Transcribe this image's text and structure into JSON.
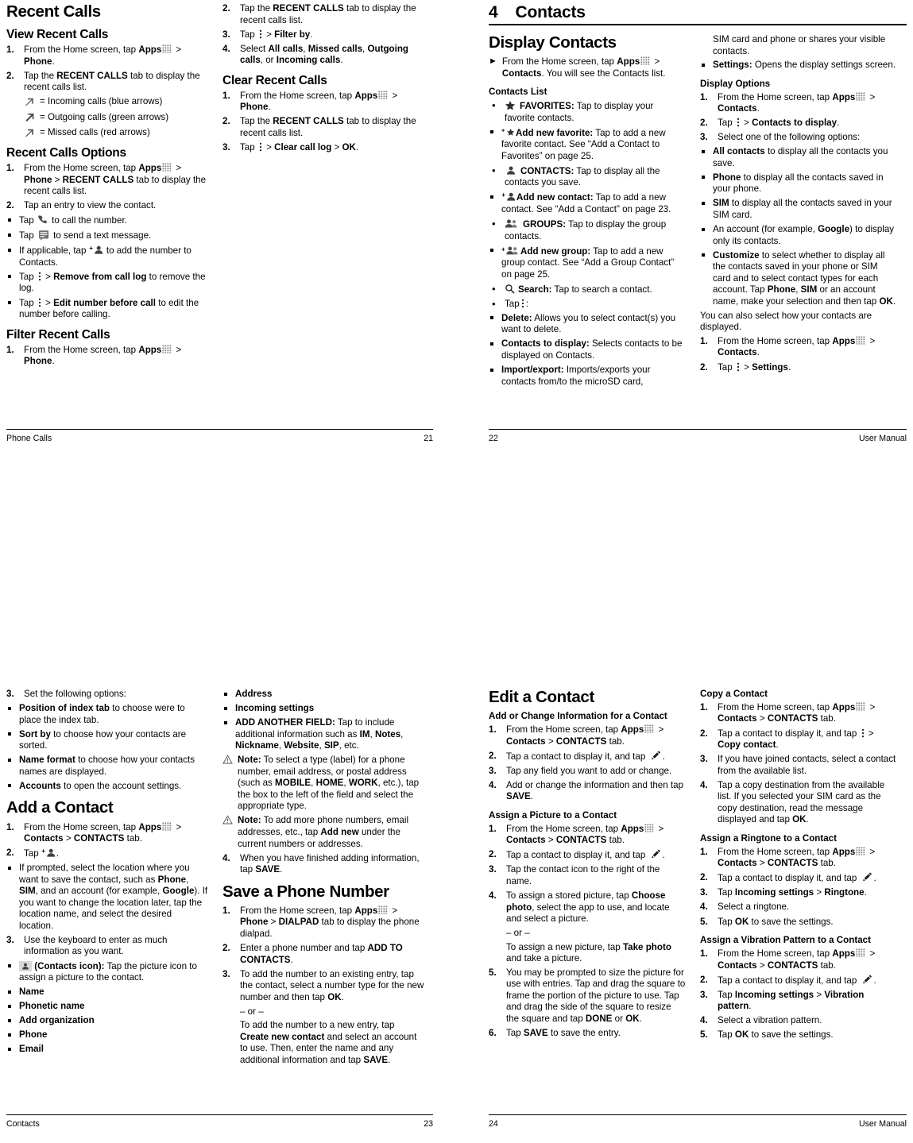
{
  "pages": {
    "p21": {
      "footer_left": "Phone Calls",
      "footer_right": "21",
      "col1": {
        "title": "Recent Calls",
        "s1_head": "View Recent Calls",
        "s1_1": "From the Home screen, tap ",
        "s1_1b": "Apps",
        "s1_1c": " > ",
        "s1_1d": "Phone",
        "s1_1e": ".",
        "s1_2": "Tap the ",
        "s1_2b": "RECENT CALLS",
        "s1_2c": " tab to display the recent calls list.",
        "legend_in": "= Incoming calls (blue arrows)",
        "legend_out": "= Outgoing calls (green arrows)",
        "legend_missed": "= Missed calls (red arrows)",
        "s2_head": "Recent Calls Options",
        "s2_1a": "From the Home screen, tap ",
        "s2_1b": "Apps",
        "s2_1c": " > ",
        "s2_1d": "Phone",
        "s2_1e": " > ",
        "s2_1f": "RECENT CALLS",
        "s2_1g": " tab to display the recent calls list.",
        "s2_2": "Tap an entry to view the contact.",
        "s2_2_a1": "Tap ",
        "s2_2_a2": " to call the number.",
        "s2_2_b1": "Tap ",
        "s2_2_b2": " to send a text message.",
        "s2_2_c1": "If applicable, tap ",
        "s2_2_c2": " to add the number to Contacts.",
        "s2_2_d1": "Tap ",
        "s2_2_d2": " > ",
        "s2_2_d3": "Remove from call log",
        "s2_2_d4": " to remove the log.",
        "s2_2_e1": "Tap ",
        "s2_2_e2": " > ",
        "s2_2_e3": "Edit number before call",
        "s2_2_e4": " to edit the number before calling.",
        "s3_head": "Filter Recent Calls",
        "s3_1a": "From the Home screen, tap ",
        "s3_1b": "Apps",
        "s3_1c": " > ",
        "s3_1d": "Phone",
        "s3_1e": "."
      },
      "col2": {
        "i2a": "Tap the ",
        "i2b": "RECENT CALLS",
        "i2c": " tab to display the recent calls list.",
        "i3a": "Tap ",
        "i3b": " > ",
        "i3c": "Filter by",
        "i3d": ".",
        "i4a": "Select ",
        "i4b": "All calls",
        "i4c": ", ",
        "i4d": "Missed calls",
        "i4e": ", ",
        "i4f": "Outgoing calls",
        "i4g": ", or ",
        "i4h": "Incoming calls",
        "i4i": ".",
        "s4_head": "Clear Recent Calls",
        "c1a": "From the Home screen, tap ",
        "c1b": "Apps",
        "c1c": " > ",
        "c1d": "Phone",
        "c1e": ".",
        "c2a": "Tap the ",
        "c2b": "RECENT CALLS",
        "c2c": " tab to display the recent calls list.",
        "c3a": "Tap ",
        "c3b": " > ",
        "c3c": "Clear call log",
        "c3d": " > ",
        "c3e": "OK",
        "c3f": "."
      }
    },
    "p22": {
      "footer_left": "22",
      "footer_right": "User Manual",
      "chapter_num": "4",
      "chapter_name": "Contacts",
      "col1": {
        "title": "Display Contacts",
        "arrow_a": "From the Home screen, tap ",
        "arrow_b": "Apps",
        "arrow_c": " > ",
        "arrow_d": "Contacts",
        "arrow_e": ". You will see the Contacts list.",
        "sub_head": "Contacts List",
        "fav_label": "FAVORITES:",
        "fav_text": " Tap to display your favorite contacts.",
        "addfav_label": "Add new favorite:",
        "addfav_text": " Tap to add a new favorite contact.  See “Add a Contact to Favorites” on page 25.",
        "con_label": "CONTACTS:",
        "con_text": " Tap to display all the contacts you save.",
        "addcon_label": "Add new contact:",
        "addcon_text": " Tap to add a new contact. See “Add a Contact” on page 23.",
        "grp_label": "GROUPS:",
        "grp_text": " Tap to display the group contacts.",
        "addgrp_label": "Add new group:",
        "addgrp_text": " Tap to add a new group contact. See “Add a Group Contact” on page 25.",
        "search_label": "Search:",
        "search_text": " Tap to search a contact.",
        "tap_kebab": "Tap",
        "tap_kebab_colon": ":",
        "del_label": "Delete:",
        "del_text": " Allows you to select contact(s) you want to delete.",
        "ctd_label": "Contacts to display:",
        "ctd_text": " Selects contacts to be displayed on Contacts.",
        "imp_label": "Import/export:",
        "imp_text": " Imports/exports your contacts from/to the microSD card,"
      },
      "col2": {
        "cont_text": "SIM card and phone or shares your visible contacts.",
        "set_label": "Settings:",
        "set_text": " Opens the display settings screen.",
        "opt_head": "Display Options",
        "o1a": "From the Home screen, tap ",
        "o1b": "Apps",
        "o1c": " > ",
        "o1d": "Contacts",
        "o1e": ".",
        "o2a": "Tap ",
        "o2b": " > ",
        "o2c": "Contacts to display",
        "o2d": ".",
        "o3": "Select one of the following options:",
        "opt_all_b": "All contacts",
        "opt_all_t": " to display all the contacts you save.",
        "opt_phone_b": "Phone",
        "opt_phone_t": " to display all the contacts saved in your phone.",
        "opt_sim_b": "SIM",
        "opt_sim_t": " to display all the contacts saved in your SIM card.",
        "opt_acct_t1": "An account (for example, ",
        "opt_acct_b": "Google",
        "opt_acct_t2": ") to display only its contacts.",
        "opt_cust_b": "Customize",
        "opt_cust_t1": " to select whether to display all the contacts saved in your phone or SIM card and to select contact types for each account. Tap ",
        "opt_cust_b2": "Phone",
        "opt_cust_t2": ", ",
        "opt_cust_b3": "SIM",
        "opt_cust_t3": " or an account name, make your selection and then tap ",
        "opt_cust_b4": "OK",
        "opt_cust_t4": ".",
        "also": "You can also select how your contacts are displayed.",
        "a1a": "From the Home screen, tap ",
        "a1b": "Apps",
        "a1c": " > ",
        "a1d": "Contacts",
        "a1e": ".",
        "a2a": "Tap ",
        "a2b": " > ",
        "a2c": "Settings",
        "a2d": "."
      }
    },
    "p23": {
      "footer_left": "Contacts",
      "footer_right": "23",
      "col1": {
        "s3": "Set the following options:",
        "o_pos_b": "Position of index tab",
        "o_pos_t": " to choose were to place the index tab.",
        "o_sort_b": "Sort by",
        "o_sort_t": " to choose how your contacts are sorted.",
        "o_name_b": "Name format",
        "o_name_t": " to choose how your contacts names are displayed.",
        "o_acct_b": "Accounts",
        "o_acct_t": " to open the account settings.",
        "title": "Add a Contact",
        "a1a": "From the Home screen, tap ",
        "a1b": "Apps",
        "a1c": " > ",
        "a1d": "Contacts",
        "a1e": " > ",
        "a1f": "CONTACTS",
        "a1g": " tab.",
        "a2a": "Tap ",
        "a2b": ".",
        "a2_sub1": "If prompted, select the location where you want to save the contact, such as ",
        "a2_sub_b1": "Phone",
        "a2_sub2": ", ",
        "a2_sub_b2": "SIM",
        "a2_sub3": ", and an account (for example, ",
        "a2_sub_b3": "Google",
        "a2_sub4": "). If you want to change the location later, tap the location name, and select the desired location.",
        "a3": "Use the keyboard to enter as much information as you want.",
        "a3_pic_b": "(Contacts icon):",
        "a3_pic_t": " Tap the picture icon to assign a picture to the contact.",
        "f_name": "Name",
        "f_phonetic": "Phonetic name",
        "f_org": "Add organization",
        "f_phone": "Phone",
        "f_email": "Email"
      },
      "col2": {
        "f_address": "Address",
        "f_incoming": "Incoming settings",
        "f_addfield_b": "ADD ANOTHER FIELD:",
        "f_addfield_t1": " Tap to include additional information such as ",
        "f_addfield_b1": "IM",
        "f_addfield_t2": ", ",
        "f_addfield_b2": "Notes",
        "f_addfield_t3": ", ",
        "f_addfield_b3": "Nickname",
        "f_addfield_t4": ", ",
        "f_addfield_b4": "Website",
        "f_addfield_t5": ", ",
        "f_addfield_b5": "SIP",
        "f_addfield_t6": ", etc.",
        "note1_b": "Note:",
        "note1_t1": " To select a type (label) for a phone number, email address, or postal address (such as ",
        "note1_b1": "MOBILE",
        "note1_t2": ", ",
        "note1_b2": "HOME",
        "note1_t3": ", ",
        "note1_b3": "WORK",
        "note1_t4": ", etc.), tap the box to the left of the field and select the appropriate type.",
        "note2_b": "Note:",
        "note2_t1": " To add more phone numbers, email addresses, etc., tap ",
        "note2_b1": "Add new",
        "note2_t2": " under the current numbers or addresses.",
        "a4a": "When you have finished adding information, tap ",
        "a4b": "SAVE",
        "a4c": ".",
        "title2": "Save a Phone Number",
        "s1a": "From the Home screen, tap ",
        "s1b": "Apps",
        "s1c": " > ",
        "s1d": "Phone",
        "s1e": " > ",
        "s1f": "DIALPAD",
        "s1g": " tab to display the phone dialpad.",
        "s2a": "Enter a phone number and tap ",
        "s2b": "ADD TO CONTACTS",
        "s2c": ".",
        "s3a": "To add the number to an existing entry, tap the contact, select a number type for the new number and then tap ",
        "s3b": "OK",
        "s3c": ".",
        "or": "– or –",
        "s3_alt1": "To add the number to a new entry, tap ",
        "s3_alt_b": "Create new contact",
        "s3_alt2": " and select an account to use. Then, enter the name and any additional information and tap ",
        "s3_alt_b2": "SAVE",
        "s3_alt3": "."
      }
    },
    "p24": {
      "footer_left": "24",
      "footer_right": "User Manual",
      "col1": {
        "title": "Edit a Contact",
        "h_add": "Add or Change Information for a Contact",
        "e1a": "From the Home screen, tap ",
        "e1b": "Apps",
        "e1c": " > ",
        "e1d": "Contacts",
        "e1e": " > ",
        "e1f": "CONTACTS",
        "e1g": " tab.",
        "e2a": "Tap a contact to display it, and tap ",
        "e2b": ".",
        "e3": "Tap any field you want to add or change.",
        "e4a": "Add or change the information and then tap ",
        "e4b": "SAVE",
        "e4c": ".",
        "h_pic": "Assign a Picture to a Contact",
        "p1a": "From the Home screen, tap ",
        "p1b": "Apps",
        "p1c": " > ",
        "p1d": "Contacts",
        "p1e": " > ",
        "p1f": "CONTACTS",
        "p1g": " tab.",
        "p2a": "Tap a contact to display it, and tap ",
        "p2b": ".",
        "p3": "Tap the contact icon to the right of the name.",
        "p4a": "To assign a stored picture, tap ",
        "p4b": "Choose photo",
        "p4c": ", select the app to use, and locate and select a picture.",
        "or": "– or –",
        "p4_alt1": "To assign a new picture, tap ",
        "p4_alt_b": "Take photo",
        "p4_alt2": " and take a picture.",
        "p5a": "You may be prompted to size the picture for use with entries. Tap and drag the square to frame the portion of the picture to use. Tap and drag the side of the square to resize the square and tap ",
        "p5b": "DONE",
        "p5c": " or ",
        "p5d": "OK",
        "p5e": ".",
        "p6a": "Tap ",
        "p6b": "SAVE",
        "p6c": " to save the entry."
      },
      "col2": {
        "h_copy": "Copy a Contact",
        "c1a": "From the Home screen, tap ",
        "c1b": "Apps",
        "c1c": " > ",
        "c1d": "Contacts",
        "c1e": " > ",
        "c1f": "CONTACTS",
        "c1g": " tab.",
        "c2a": "Tap a contact to display it, and tap ",
        "c2b": " > ",
        "c2c": "Copy contact",
        "c2d": ".",
        "c3": "If you have joined contacts, select a contact from the available list.",
        "c4a": "Tap a copy destination from the available list. If you selected your SIM card as the copy destination, read the message displayed and tap ",
        "c4b": "OK",
        "c4c": ".",
        "h_ring": "Assign a Ringtone to a Contact",
        "r1a": "From the Home screen, tap ",
        "r1b": "Apps",
        "r1c": " > ",
        "r1d": "Contacts",
        "r1e": " > ",
        "r1f": "CONTACTS",
        "r1g": " tab.",
        "r2a": "Tap a contact to display it, and tap ",
        "r2b": ".",
        "r3a": "Tap ",
        "r3b": "Incoming settings",
        "r3c": " > ",
        "r3d": "Ringtone",
        "r3e": ".",
        "r4": "Select a ringtone.",
        "r5a": "Tap ",
        "r5b": "OK",
        "r5c": " to save the settings.",
        "h_vib": "Assign a Vibration Pattern to a Contact",
        "v1a": "From the Home screen, tap ",
        "v1b": "Apps",
        "v1c": " > ",
        "v1d": "Contacts",
        "v1e": " > ",
        "v1f": "CONTACTS",
        "v1g": " tab.",
        "v2a": "Tap a contact to display it, and tap ",
        "v2b": ".",
        "v3a": "Tap ",
        "v3b": "Incoming settings",
        "v3c": " > ",
        "v3d": "Vibration pattern",
        "v3e": ".",
        "v4": "Select a vibration pattern.",
        "v5a": "Tap ",
        "v5b": "OK",
        "v5c": " to save the settings."
      }
    }
  },
  "numbers": {
    "n1": "1.",
    "n2": "2.",
    "n3": "3.",
    "n4": "4.",
    "n5": "5.",
    "n6": "6."
  },
  "icons": {
    "apps": "apps-grid-icon",
    "kebab": "overflow-menu-icon",
    "phone": "phone-handset-icon",
    "message": "message-icon",
    "add_contact": "add-contact-icon",
    "star": "star-icon",
    "add_star": "add-favorite-icon",
    "person": "person-icon",
    "group": "group-icon",
    "add_group": "add-group-icon",
    "search": "search-icon",
    "pencil": "pencil-edit-icon",
    "warning": "warning-note-icon",
    "incoming_arrow": "incoming-call-arrow-icon",
    "outgoing_arrow": "outgoing-call-arrow-icon",
    "missed_arrow": "missed-call-arrow-icon",
    "contacts_picture": "contacts-picture-icon"
  }
}
